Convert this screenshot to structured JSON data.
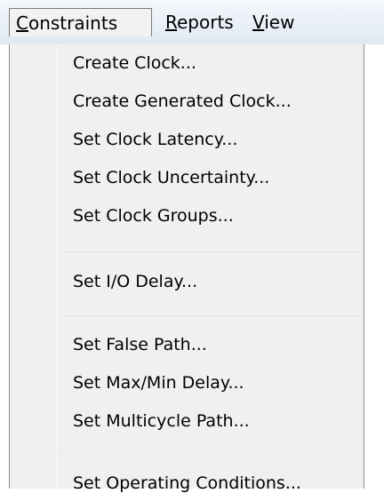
{
  "menubar": {
    "items": [
      {
        "mnemonic": "C",
        "rest": "onstraints"
      },
      {
        "mnemonic": "R",
        "rest": "eports"
      },
      {
        "mnemonic": "V",
        "rest": "iew"
      }
    ]
  },
  "dropdown": {
    "groups": [
      [
        "Create Clock...",
        "Create Generated Clock...",
        "Set Clock Latency...",
        "Set Clock Uncertainty...",
        "Set Clock Groups..."
      ],
      [
        "Set I/O Delay..."
      ],
      [
        "Set False Path...",
        "Set Max/Min Delay...",
        "Set Multicycle Path..."
      ],
      [
        "Set Operating Conditions..."
      ]
    ]
  }
}
